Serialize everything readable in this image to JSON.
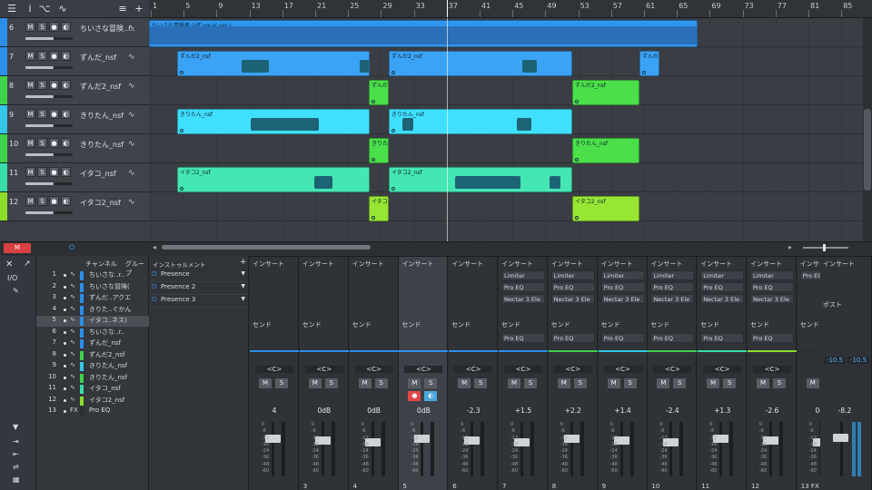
{
  "toolbar": {
    "icons": [
      "menu-icon",
      "info-icon",
      "tool-icon",
      "curve-icon",
      "list-icon",
      "plus-icon"
    ]
  },
  "ruler": {
    "bars": [
      "1",
      "5",
      "9",
      "13",
      "17",
      "21",
      "25",
      "29",
      "33",
      "37",
      "41",
      "45",
      "49",
      "53",
      "57",
      "61",
      "65",
      "69",
      "73",
      "77",
      "81",
      "85"
    ]
  },
  "tracks": [
    {
      "num": "6",
      "name": "ちいさな冒険..r..",
      "color": "#2c8ee8",
      "m": "M",
      "s": "S"
    },
    {
      "num": "7",
      "name": "ずんだ_nsf",
      "color": "#2c8ee8",
      "m": "M",
      "s": "S"
    },
    {
      "num": "8",
      "name": "ずんだ2_nsf",
      "color": "#3fd14a",
      "m": "M",
      "s": "S"
    },
    {
      "num": "9",
      "name": "きりたん_nsf",
      "color": "#33c6e6",
      "m": "M",
      "s": "S"
    },
    {
      "num": "10",
      "name": "きりたん_nsf",
      "color": "#3fd14a",
      "m": "M",
      "s": "S"
    },
    {
      "num": "11",
      "name": "イタコ_nsf",
      "color": "#38dca9",
      "m": "M",
      "s": "S"
    },
    {
      "num": "12",
      "name": "イタコ2_nsf",
      "color": "#8ddc2a",
      "m": "M",
      "s": "S"
    }
  ],
  "clips": [
    {
      "lane": 0,
      "label": "ちいさな冒険者 (off vocal ver.)",
      "color": "#2f96ee"
    },
    {
      "lane": 1,
      "label": "ずんだ2_nsf",
      "color": "#3ba3f5"
    },
    {
      "lane": 1,
      "label": "ずんだ2_nsf",
      "color": "#3ba3f5"
    },
    {
      "lane": 1,
      "label": "ずんだ2",
      "color": "#3ba3f5"
    },
    {
      "lane": 2,
      "label": "ずんだ",
      "color": "#4be04a"
    },
    {
      "lane": 2,
      "label": "ずんだ2_nsf",
      "color": "#4be04a"
    },
    {
      "lane": 3,
      "label": "きりたん_nsf",
      "color": "#3fe0ff"
    },
    {
      "lane": 3,
      "label": "きりたん_nsf",
      "color": "#3fe0ff"
    },
    {
      "lane": 4,
      "label": "きりたん",
      "color": "#4be04a"
    },
    {
      "lane": 4,
      "label": "きりたん_nsf",
      "color": "#4be04a"
    },
    {
      "lane": 5,
      "label": "イタコ2_nsf",
      "color": "#44e6b3"
    },
    {
      "lane": 5,
      "label": "イタコ2_nsf",
      "color": "#44e6b3"
    },
    {
      "lane": 6,
      "label": "イタコ",
      "color": "#97e634"
    },
    {
      "lane": 6,
      "label": "イタコ2_nsf",
      "color": "#97e634"
    }
  ],
  "arrange_bottom": {
    "m_label": "M"
  },
  "mixer_side": {
    "io": "I/O"
  },
  "channel_list": {
    "headers": {
      "channel": "チャンネル",
      "group": "グループ"
    },
    "rows": [
      {
        "n": "1",
        "name": "ちいさな..r..",
        "color": "#2c8ee8"
      },
      {
        "n": "2",
        "name": "ちいさな冒険(",
        "color": "#2c8ee8"
      },
      {
        "n": "3",
        "name": "ずんだ..アクエ",
        "color": "#2c8ee8"
      },
      {
        "n": "4",
        "name": "きりた..ぐかん",
        "color": "#2c8ee8"
      },
      {
        "n": "5",
        "name": "イタコ..ネス)",
        "color": "#2c8ee8"
      },
      {
        "n": "6",
        "name": "ちいさな..r..",
        "color": "#2c8ee8"
      },
      {
        "n": "7",
        "name": "ずんだ_nsf",
        "color": "#2c8ee8"
      },
      {
        "n": "8",
        "name": "ずんだ2_nsf",
        "color": "#3fd14a"
      },
      {
        "n": "9",
        "name": "きりたん_nsf",
        "color": "#33c6e6"
      },
      {
        "n": "10",
        "name": "きりたん_nsf",
        "color": "#3fd14a"
      },
      {
        "n": "11",
        "name": "イタコ_nsf",
        "color": "#38dca9"
      },
      {
        "n": "12",
        "name": "イタコ2_nsf",
        "color": "#8ddc2a"
      },
      {
        "n": "13",
        "name": "Pro EQ",
        "color": "#2b2e33"
      }
    ],
    "fx_tag": "FX"
  },
  "instruments": {
    "header": "インストゥルメント",
    "items": [
      "Presence",
      "Presence 2",
      "Presence 3"
    ]
  },
  "strips": [
    {
      "ins": "インサート",
      "slots": [],
      "send": "センド",
      "pan": "<C>",
      "vol": "4",
      "num": "",
      "color": "#2c8ee8",
      "m": "M",
      "s": "S"
    },
    {
      "ins": "インサート",
      "slots": [],
      "send": "センド",
      "pan": "<C>",
      "vol": "0dB",
      "num": "3",
      "color": "#2c8ee8",
      "m": "M",
      "s": "S"
    },
    {
      "ins": "インサート",
      "slots": [],
      "send": "センド",
      "pan": "<C>",
      "vol": "0dB",
      "num": "4",
      "color": "#2c8ee8",
      "m": "M",
      "s": "S"
    },
    {
      "ins": "インサート",
      "slots": [],
      "send": "センド",
      "pan": "<C>",
      "vol": "0dB",
      "num": "5",
      "color": "#2c8ee8",
      "m": "M",
      "s": "S"
    },
    {
      "ins": "インサート",
      "slots": [],
      "send": "センド",
      "pan": "<C>",
      "vol": "-2.3",
      "num": "6",
      "color": "#2c8ee8",
      "m": "M",
      "s": "S"
    },
    {
      "ins": "インサート",
      "slots": [
        "Limiter",
        "Pro EQ",
        "Nectar 3 Ele"
      ],
      "send": "センド",
      "pan": "<C>",
      "vol": "+1.5",
      "num": "7",
      "color": "#2c8ee8",
      "m": "M",
      "s": "S"
    },
    {
      "ins": "インサート",
      "slots": [
        "Limiter",
        "Pro EQ",
        "Nectar 3 Ele"
      ],
      "send": "センド",
      "pan": "<C>",
      "vol": "+2.2",
      "num": "8",
      "color": "#3fd14a",
      "m": "M",
      "s": "S"
    },
    {
      "ins": "インサート",
      "slots": [
        "Limiter",
        "Pro EQ",
        "Nectar 3 Ele"
      ],
      "send": "センド",
      "pan": "<C>",
      "vol": "+1.4",
      "num": "9",
      "color": "#33c6e6",
      "m": "M",
      "s": "S"
    },
    {
      "ins": "インサート",
      "slots": [
        "Limiter",
        "Pro EQ",
        "Nectar 3 Ele"
      ],
      "send": "センド",
      "pan": "<C>",
      "vol": "-2.4",
      "num": "10",
      "color": "#3fd14a",
      "m": "M",
      "s": "S"
    },
    {
      "ins": "インサート",
      "slots": [
        "Limiter",
        "Pro EQ",
        "Nectar 3 Ele"
      ],
      "send": "センド",
      "pan": "<C>",
      "vol": "+1.3",
      "num": "11",
      "color": "#38dca9",
      "m": "M",
      "s": "S"
    },
    {
      "ins": "インサート",
      "slots": [
        "Limiter",
        "Pro EQ",
        "Nectar 3 Ele"
      ],
      "send": "センド",
      "pan": "<C>",
      "vol": "-2.6",
      "num": "12",
      "color": "#8ddc2a",
      "m": "M",
      "s": "S"
    },
    {
      "ins": "インサート",
      "slots": [
        "Pro EQ"
      ],
      "send": "センド",
      "pan": "",
      "vol": "0dB",
      "num": "13",
      "color": "#2b2e33",
      "m": "M",
      "s": "S",
      "fx": "FX"
    }
  ],
  "master": {
    "ins": "インサート",
    "post": "ポスト",
    "l": "-10.5",
    "r": "-10.5",
    "vol": "-8.2"
  },
  "fader_scale": [
    "0",
    "-6",
    "-12",
    "-18",
    "-24",
    "-36",
    "-48",
    "-60"
  ]
}
